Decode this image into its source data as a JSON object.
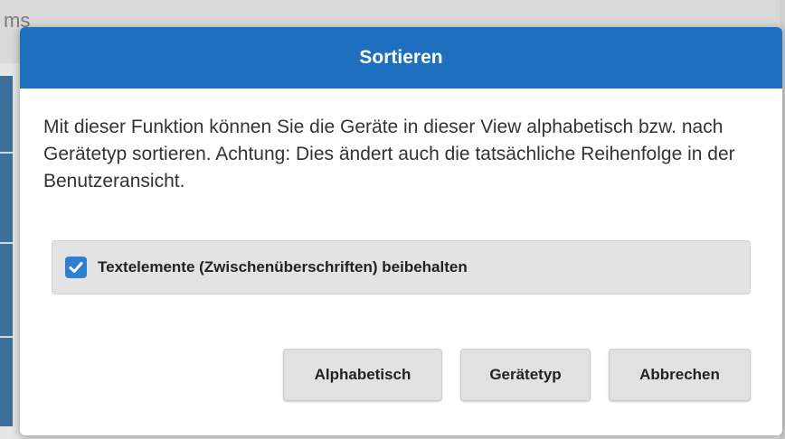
{
  "background": {
    "tab_text": "ms"
  },
  "dialog": {
    "title": "Sortieren",
    "message": "Mit dieser Funktion können Sie die Geräte in dieser View alphabetisch bzw. nach Gerätetyp sortieren. Achtung: Dies ändert auch die tatsächliche Reihenfolge in der Benutzeransicht.",
    "option": {
      "label": "Textelemente (Zwischenüberschriften) beibehalten",
      "checked": true
    },
    "buttons": {
      "alphabetical": "Alphabetisch",
      "device_type": "Gerätetyp",
      "cancel": "Abbrechen"
    }
  },
  "colors": {
    "header": "#1e6fbf",
    "checkbox": "#2f7fd1",
    "button_bg": "#e1e1e1"
  }
}
